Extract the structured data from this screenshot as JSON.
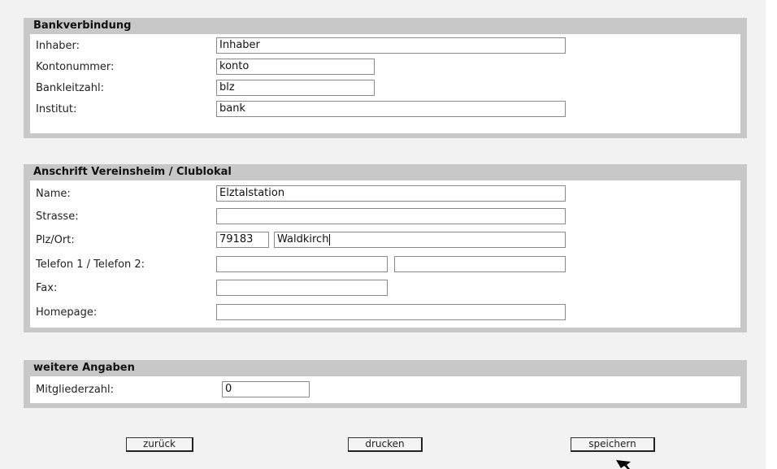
{
  "bank": {
    "title": "Bankverbindung",
    "owner_label": "Inhaber:",
    "owner_value": "Inhaber",
    "account_label": "Kontonummer:",
    "account_value": "konto",
    "blz_label": "Bankleitzahl:",
    "blz_value": "blz",
    "institute_label": "Institut:",
    "institute_value": "bank"
  },
  "address": {
    "title": "Anschrift Vereinsheim / Clublokal",
    "name_label": "Name:",
    "name_value": "Elztalstation",
    "street_label": "Strasse:",
    "street_value": "",
    "zip_city_label": "Plz/Ort:",
    "zip_value": "79183",
    "city_value": "Waldkirch",
    "phone_label": "Telefon 1 / Telefon 2:",
    "phone1_value": "",
    "phone2_value": "",
    "fax_label": "Fax:",
    "fax_value": "",
    "homepage_label": "Homepage:",
    "homepage_value": ""
  },
  "more": {
    "title": "weitere Angaben",
    "members_label": "Mitgliederzahl:",
    "members_value": "0"
  },
  "buttons": {
    "back": "zurück",
    "print": "drucken",
    "save": "speichern"
  }
}
